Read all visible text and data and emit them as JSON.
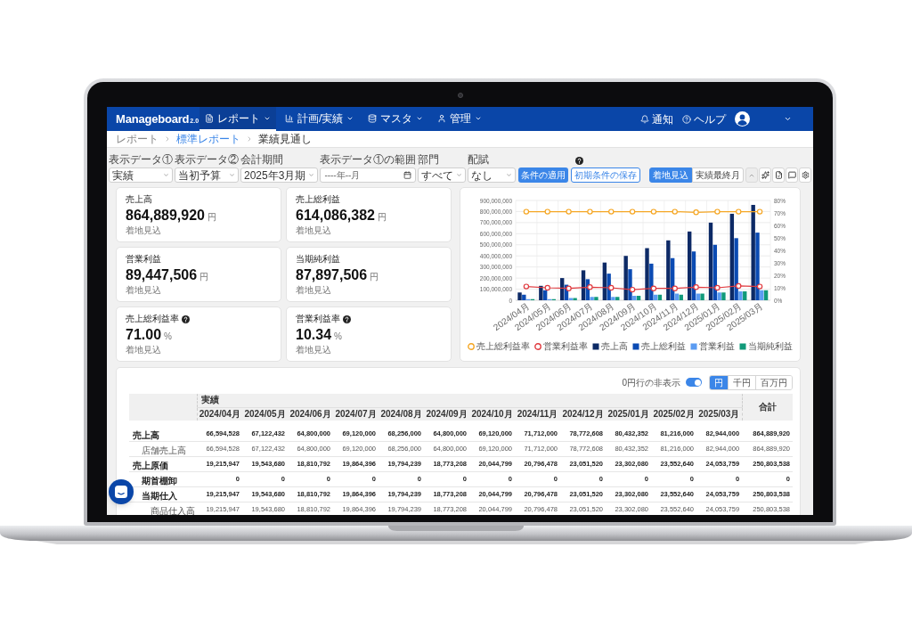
{
  "nav": {
    "logo": "Manageboard",
    "logo_version": "2.0",
    "menus": [
      {
        "label": "レポート",
        "selected": true
      },
      {
        "label": "計画/実績",
        "selected": false
      },
      {
        "label": "マスタ",
        "selected": false
      },
      {
        "label": "管理",
        "selected": false
      }
    ],
    "notifications": "通知",
    "help": "ヘルプ"
  },
  "breadcrumbs": [
    {
      "label": "レポート",
      "kind": "plain"
    },
    {
      "label": "標準レポート",
      "kind": "link"
    },
    {
      "label": "業績見通し",
      "kind": "current"
    }
  ],
  "filters": [
    {
      "label": "表示データ①",
      "kind": "select",
      "value": "実績"
    },
    {
      "label": "表示データ②",
      "kind": "select",
      "value": "当初予算"
    },
    {
      "label": "会計期間",
      "kind": "select",
      "value": "2025年3月期"
    },
    {
      "label": "表示データ①の範囲",
      "kind": "month",
      "placeholder": "----年--月"
    },
    {
      "label": "部門",
      "kind": "select",
      "value": "すべて"
    },
    {
      "label": "配賦",
      "kind": "select",
      "value": "なし"
    }
  ],
  "apply_button": "条件の適用",
  "save_button": "初期条件の保存",
  "view_modes": [
    {
      "label": "着地見込",
      "selected": true
    },
    {
      "label": "実績最終月",
      "selected": false
    }
  ],
  "kpis": [
    {
      "title": "売上高",
      "value": "864,889,920",
      "unit": "円",
      "note": "着地見込",
      "help": false
    },
    {
      "title": "売上総利益",
      "value": "614,086,382",
      "unit": "円",
      "note": "着地見込",
      "help": false
    },
    {
      "title": "営業利益",
      "value": "89,447,506",
      "unit": "円",
      "note": "着地見込",
      "help": false
    },
    {
      "title": "当期純利益",
      "value": "87,897,506",
      "unit": "円",
      "note": "着地見込",
      "help": false
    },
    {
      "title": "売上総利益率",
      "value": "71.00",
      "unit": "%",
      "note": "着地見込",
      "help": true
    },
    {
      "title": "営業利益率",
      "value": "10.34",
      "unit": "%",
      "note": "着地見込",
      "help": true
    }
  ],
  "chart": {
    "chart_data": {
      "type": "bar",
      "categories": [
        "2024/04月",
        "2024/05月",
        "2024/06月",
        "2024/07月",
        "2024/08月",
        "2024/09月",
        "2024/10月",
        "2024/11月",
        "2024/12月",
        "2025/01月",
        "2025/02月",
        "2025/03月"
      ],
      "ylim": [
        0,
        900000000
      ],
      "yticks": [
        {
          "value": 0,
          "label": "0"
        },
        {
          "value": 100000000,
          "label": "100,000,000"
        },
        {
          "value": 200000000,
          "label": "200,000,000"
        },
        {
          "value": 300000000,
          "label": "300,000,000"
        },
        {
          "value": 400000000,
          "label": "400,000,000"
        },
        {
          "value": 500000000,
          "label": "500,000,000"
        },
        {
          "value": 600000000,
          "label": "600,000,000"
        },
        {
          "value": 700000000,
          "label": "700,000,000"
        },
        {
          "value": 800000000,
          "label": "800,000,000"
        },
        {
          "value": 900000000,
          "label": "900,000,000"
        }
      ],
      "y2lim": [
        0,
        80
      ],
      "y2ticks": [
        {
          "value": 0,
          "label": "0%"
        },
        {
          "value": 10,
          "label": "10%"
        },
        {
          "value": 20,
          "label": "20%"
        },
        {
          "value": 30,
          "label": "30%"
        },
        {
          "value": 40,
          "label": "40%"
        },
        {
          "value": 50,
          "label": "50%"
        },
        {
          "value": 60,
          "label": "60%"
        },
        {
          "value": 70,
          "label": "70%"
        },
        {
          "value": 80,
          "label": "80%"
        }
      ],
      "grid": true,
      "legend": "bottom",
      "series": [
        {
          "name": "売上総利益率",
          "color": "#f5a623",
          "type": "line",
          "axis": "y2",
          "marker": "circle",
          "values": [
            71,
            71,
            71,
            71,
            71,
            71,
            71,
            71,
            70.5,
            71,
            71,
            71
          ]
        },
        {
          "name": "営業利益率",
          "color": "#e0393e",
          "type": "line",
          "axis": "y2",
          "marker": "circle",
          "values": [
            11,
            10,
            9.5,
            10.5,
            10,
            8.5,
            9.5,
            9.5,
            10.5,
            10,
            11.5,
            11
          ]
        },
        {
          "name": "売上高",
          "color": "#0d2a66",
          "type": "bar",
          "values": [
            70000000,
            130000000,
            200000000,
            270000000,
            340000000,
            400000000,
            470000000,
            540000000,
            620000000,
            700000000,
            780000000,
            860000000
          ]
        },
        {
          "name": "売上総利益",
          "color": "#0b4bb3",
          "type": "bar",
          "values": [
            50000000,
            90000000,
            140000000,
            190000000,
            240000000,
            280000000,
            330000000,
            380000000,
            440000000,
            500000000,
            560000000,
            610000000
          ]
        },
        {
          "name": "営業利益",
          "color": "#5b9cf2",
          "type": "bar",
          "values": [
            10000000,
            10000000,
            20000000,
            30000000,
            30000000,
            40000000,
            50000000,
            60000000,
            60000000,
            70000000,
            80000000,
            90000000
          ]
        },
        {
          "name": "当期純利益",
          "color": "#119a7a",
          "type": "bar",
          "values": [
            10000000,
            10000000,
            20000000,
            30000000,
            30000000,
            40000000,
            50000000,
            50000000,
            60000000,
            70000000,
            80000000,
            90000000
          ]
        }
      ]
    }
  },
  "table": {
    "zero_rows_toggle": {
      "label": "0円行の非表示",
      "on": true
    },
    "units": [
      {
        "label": "円",
        "selected": true
      },
      {
        "label": "千円",
        "selected": false
      },
      {
        "label": "百万円",
        "selected": false
      }
    ],
    "group_header": "実績",
    "columns": [
      "2024/04月",
      "2024/05月",
      "2024/06月",
      "2024/07月",
      "2024/08月",
      "2024/09月",
      "2024/10月",
      "2024/11月",
      "2024/12月",
      "2025/01月",
      "2025/02月",
      "2025/03月"
    ],
    "total_header": "合計",
    "rows": [
      {
        "label": "売上高",
        "bold": true,
        "values": [
          "66,594,528",
          "67,122,432",
          "64,800,000",
          "69,120,000",
          "68,256,000",
          "64,800,000",
          "69,120,000",
          "71,712,000",
          "78,772,608",
          "80,432,352",
          "81,216,000",
          "82,944,000"
        ],
        "total": "864,889,920",
        "children": [
          {
            "label": "店舗売上高",
            "bold": false,
            "values": [
              "66,594,528",
              "67,122,432",
              "64,800,000",
              "69,120,000",
              "68,256,000",
              "64,800,000",
              "69,120,000",
              "71,712,000",
              "78,772,608",
              "80,432,352",
              "81,216,000",
              "82,944,000"
            ],
            "total": "864,889,920"
          }
        ]
      },
      {
        "label": "売上原価",
        "bold": true,
        "values": [
          "19,215,947",
          "19,543,680",
          "18,810,792",
          "19,864,396",
          "19,794,239",
          "18,773,208",
          "20,044,799",
          "20,796,478",
          "23,051,520",
          "23,302,080",
          "23,552,640",
          "24,053,759"
        ],
        "total": "250,803,538",
        "children": [
          {
            "label": "期首棚卸",
            "bold": true,
            "values": [
              "0",
              "0",
              "0",
              "0",
              "0",
              "0",
              "0",
              "0",
              "0",
              "0",
              "0",
              "0"
            ],
            "total": "0"
          },
          {
            "label": "当期仕入",
            "bold": true,
            "values": [
              "19,215,947",
              "19,543,680",
              "18,810,792",
              "19,864,396",
              "19,794,239",
              "18,773,208",
              "20,044,799",
              "20,796,478",
              "23,051,520",
              "23,302,080",
              "23,552,640",
              "24,053,759"
            ],
            "total": "250,803,538",
            "children": [
              {
                "label": "商品仕入高",
                "bold": false,
                "values": [
                  "19,215,947",
                  "19,543,680",
                  "18,810,792",
                  "19,864,396",
                  "19,794,239",
                  "18,773,208",
                  "20,044,799",
                  "20,796,478",
                  "23,051,520",
                  "23,302,080",
                  "23,552,640",
                  "24,053,759"
                ],
                "total": "250,803,538"
              }
            ]
          }
        ]
      }
    ]
  }
}
